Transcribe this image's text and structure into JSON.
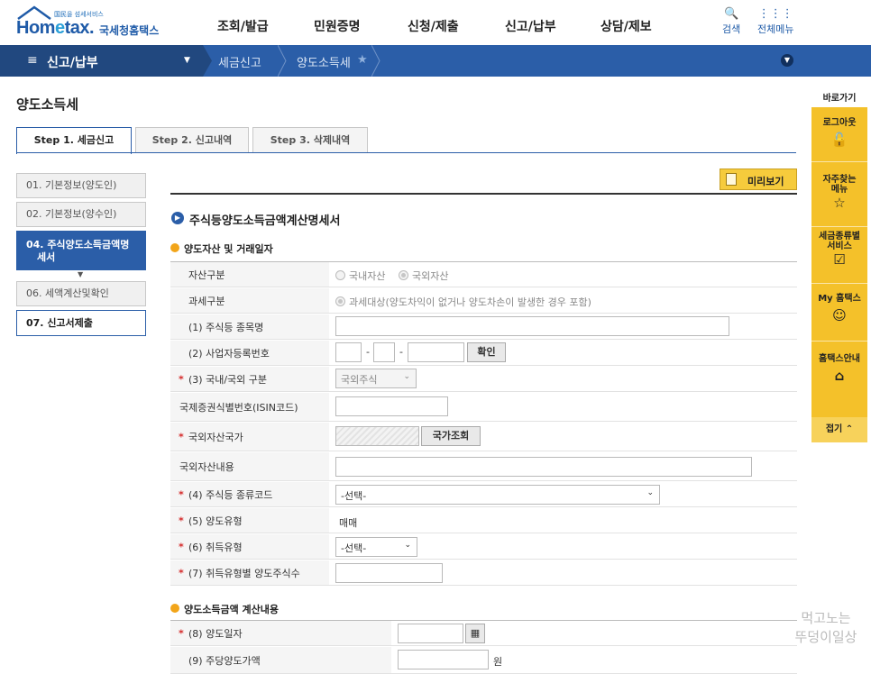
{
  "header": {
    "logo_tagline": "国民을 섬세서비스",
    "logo_word_pre": "Hom",
    "logo_word_e": "e",
    "logo_word_post": "tax.",
    "logo_sub": "국세청홈택스",
    "gnb": [
      "조회/발급",
      "민원증명",
      "신청/제출",
      "신고/납부",
      "상담/제보"
    ],
    "search_label": "검색",
    "allmenu_label": "전체메뉴"
  },
  "nav": {
    "main": "신고/납부",
    "crumb1": "세금신고",
    "crumb2": "양도소득세"
  },
  "page_title": "양도소득세",
  "steps": [
    "Step 1. 세금신고",
    "Step 2. 신고내역",
    "Step 3. 삭제내역"
  ],
  "left_steps": {
    "s1": "01. 기본정보(양도인)",
    "s2": "02. 기본정보(양수인)",
    "s4a": "04. 주식양도소득금액명",
    "s4b": "세서",
    "s6": "06. 세액계산및확인",
    "s7": "07. 신고서제출"
  },
  "preview_label": "미리보기",
  "form_title": "주식등양도소득금액계산명세서",
  "section1": "양도자산 및 거래일자",
  "section2": "양도소득금액 계산내용",
  "rows": {
    "asset_type": "자산구분",
    "asset_opt1": "국내자산",
    "asset_opt2": "국외자산",
    "tax_type": "과세구분",
    "tax_opt": "과세대상(양도차익이 없거나 양도차손이 발생한 경우 포함)",
    "stock_name": "(1) 주식등 종목명",
    "biz_no": "(2) 사업자등록번호",
    "confirm_btn": "확인",
    "dom_foreign": "(3) 국내/국외 구분",
    "dom_foreign_val": "국외주식",
    "isin": "국제증권식별번호(ISIN코드)",
    "foreign_country": "국외자산국가",
    "country_btn": "국가조회",
    "foreign_content": "국외자산내용",
    "stock_code": "(4) 주식등 종류코드",
    "stock_code_val": "-선택-",
    "transfer_type": "(5) 양도유형",
    "transfer_type_val": "매매",
    "acq_type": "(6) 취득유형",
    "acq_type_val": "-선택-",
    "acq_qty": "(7) 취득유형별 양도주식수",
    "transfer_date": "(8) 양도일자",
    "unit_price": "(9) 주당양도가액",
    "won": "원"
  },
  "quick": {
    "head": "바로가기",
    "logout": "로그아웃",
    "faq1": "자주찾는",
    "faq2": "메뉴",
    "tax1": "세금종류별",
    "tax2": "서비스",
    "my": "My 홈택스",
    "guide": "홈택스안내",
    "close": "접기"
  },
  "watermark": [
    "먹고노는",
    "뚜덩이일상"
  ],
  "colors": {
    "primary": "#2b5ea8",
    "nav_dark": "#21487f",
    "accent_yellow": "#f4c12a",
    "required": "#d52a2a"
  }
}
